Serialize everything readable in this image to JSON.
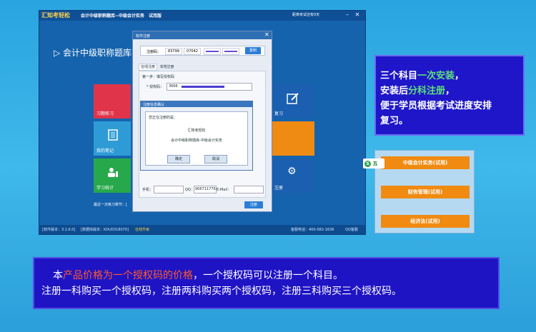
{
  "app": {
    "logo": "汇知考轻松",
    "title": "会计中级职称题库--中级会计实务",
    "trial": "试用版",
    "countdown": "距离考试还有0天",
    "heading": "会计中级职称题库--",
    "tiles": {
      "practice": "习题练习",
      "notes": "我的笔记",
      "stats": "学习统计",
      "review": "复习",
      "register": "注册"
    },
    "last_practice": "最近一次练习章节：[",
    "status": {
      "version": "[软件版本：3.1.6.0]",
      "db_version": "[数据库版本：KDU0318070]",
      "upgrade": "在线升级",
      "hotline": "客服电话：400-082-1636",
      "qq": "QQ客服"
    }
  },
  "register_dialog": {
    "title": "软件注册",
    "code_label": "注册码：",
    "code1": "83799",
    "code2": "07042",
    "copy_button": "复制",
    "tab_online": "在线注册",
    "tab_manual": "本地注册",
    "step1": "第一步：填写授权码",
    "auth_label": "* 授权码：",
    "auth_value": "3666",
    "phone_label": "手机：",
    "qq_label": "QQ：",
    "qq_value": "906711776",
    "email_label": "E-Mail：",
    "submit": "注册"
  },
  "confirm_dialog": {
    "title": "注册信息确认",
    "question": "您正在注册的是：",
    "product_brand": "汇知考轻松",
    "product_name": "会计中级职称题库-中级会计实务",
    "ok": "确定",
    "cancel": "取消"
  },
  "callout": {
    "line1_a": "三个科目",
    "line1_b": "一次安装",
    "line1_c": "，",
    "line2_a": "安装后",
    "line2_b": "分科注册",
    "line2_c": "，",
    "line3": "便于学员根据考试进度安排",
    "line4": "复习。"
  },
  "courses": [
    "中级会计实务(试用)",
    "财务管理(试用)",
    "经济法(试用)"
  ],
  "badge": "五",
  "banner": {
    "l1_a": "本",
    "l1_b": "产品价格为一个授权码的价格",
    "l1_c": "，一个授权码可以注册一个科目。",
    "l2": "注册一科购买一个授权码，注册两科购买两个授权码，注册三科购买三个授权码。"
  },
  "colors": {
    "practice": "#e0344a",
    "notes": "#2f9bd6",
    "stats": "#27a84a",
    "review": "#1b5fb0",
    "orange": "#ef8a12"
  }
}
